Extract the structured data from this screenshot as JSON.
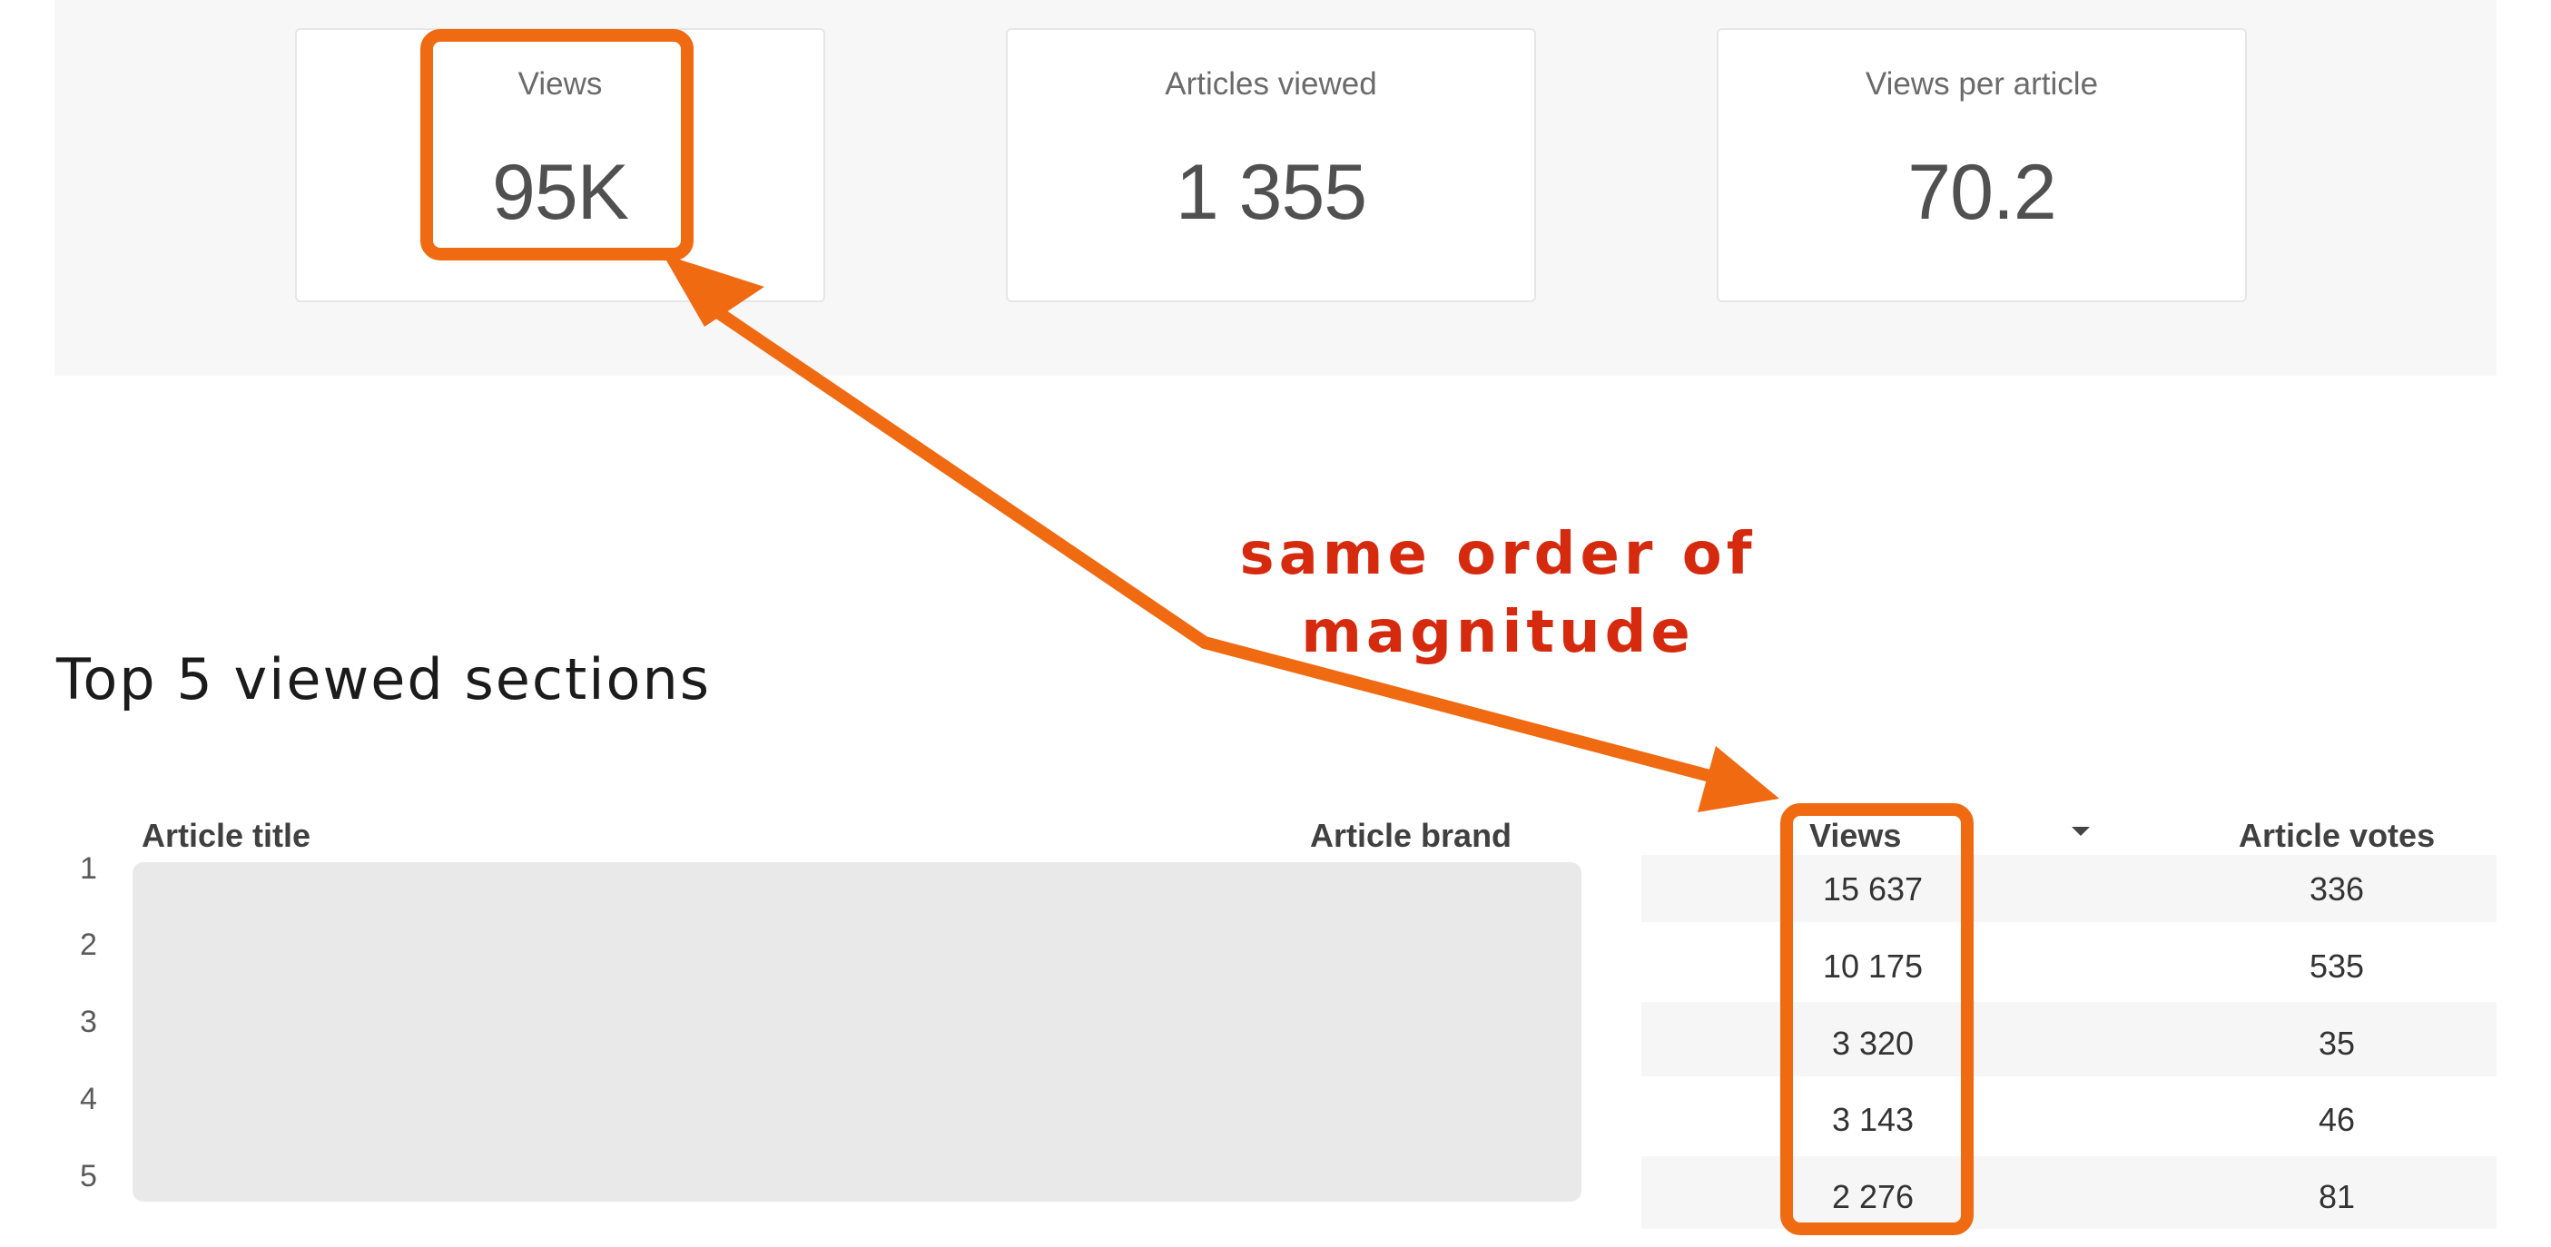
{
  "kpis": [
    {
      "label": "Views",
      "value": "95K"
    },
    {
      "label": "Articles viewed",
      "value": "1 355"
    },
    {
      "label": "Views per article",
      "value": "70.2"
    }
  ],
  "annotation": {
    "line1": "same order of",
    "line2": "magnitude",
    "text_color": "#d62a0e",
    "highlight_color": "#f06a12"
  },
  "section": {
    "title": "Top 5 viewed sections"
  },
  "table": {
    "headers": {
      "title": "Article title",
      "brand": "Article brand",
      "views": "Views",
      "votes": "Article votes"
    },
    "rows": [
      {
        "num": "1",
        "views": "15 637",
        "votes": "336"
      },
      {
        "num": "2",
        "views": "10 175",
        "votes": "535"
      },
      {
        "num": "3",
        "views": "3 320",
        "votes": "35"
      },
      {
        "num": "4",
        "views": "3 143",
        "votes": "46"
      },
      {
        "num": "5",
        "views": "2 276",
        "votes": "81"
      }
    ]
  },
  "icons": {
    "sort": "sort-descending-icon"
  }
}
